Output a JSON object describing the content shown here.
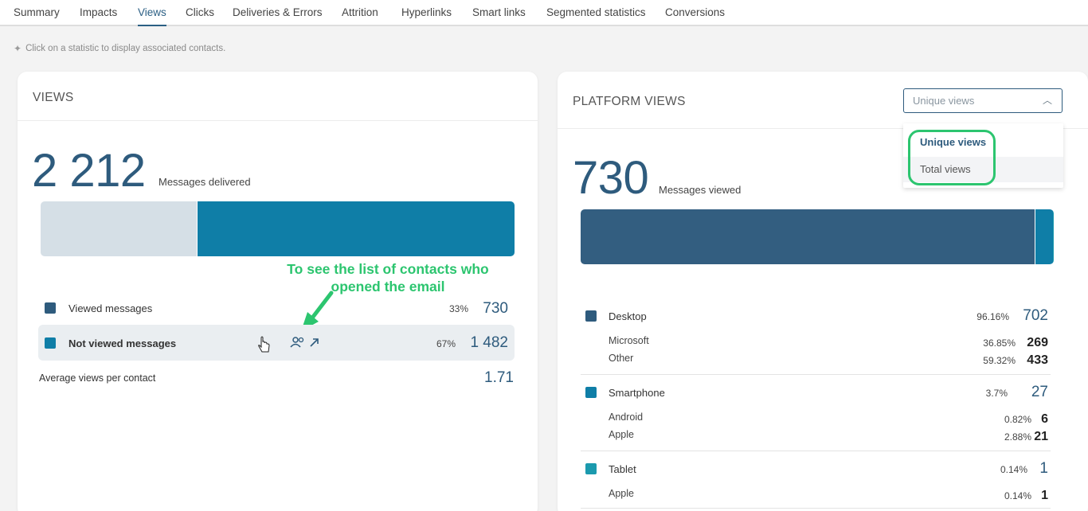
{
  "tabs": [
    "Summary",
    "Impacts",
    "Views",
    "Clicks",
    "Deliveries & Errors",
    "Attrition",
    "Hyperlinks",
    "Smart links",
    "Segmented statistics",
    "Conversions"
  ],
  "active_tab": "Views",
  "hint": "Click on a statistic to display associated contacts.",
  "views_card": {
    "title": "VIEWS",
    "total": "2 212",
    "total_label": "Messages delivered",
    "bar": {
      "viewed_fraction": 0.33,
      "not_viewed_fraction": 0.67
    },
    "rows": [
      {
        "label": "Viewed messages",
        "pct": "33%",
        "value": "730",
        "color": "#2e5b7d"
      },
      {
        "label": "Not viewed messages",
        "pct": "67%",
        "value": "1 482",
        "color": "#0f7ea7"
      }
    ],
    "avg_label": "Average views per contact",
    "avg_value": "1.71",
    "annotation": "To see the list of contacts who opened the email"
  },
  "platform_card": {
    "title": "PLATFORM VIEWS",
    "dropdown_value": "Unique views",
    "dropdown_options": [
      "Unique views",
      "Total views"
    ],
    "total": "730",
    "total_label": "Messages viewed",
    "bar": {
      "desktop_fraction": 0.9616,
      "smartphone_fraction": 0.037,
      "tablet_fraction": 0.0014
    },
    "groups": [
      {
        "label": "Desktop",
        "pct": "96.16%",
        "value": "702",
        "color": "#2e5b7d",
        "subs": [
          {
            "label": "Microsoft",
            "pct": "36.85%",
            "value": "269"
          },
          {
            "label": "Other",
            "pct": "59.32%",
            "value": "433"
          }
        ]
      },
      {
        "label": "Smartphone",
        "pct": "3.7%",
        "value": "27",
        "color": "#0f7ea7",
        "subs": [
          {
            "label": "Android",
            "pct": "0.82%",
            "value": "6"
          },
          {
            "label": "Apple",
            "pct": "2.88%",
            "value": "21"
          }
        ]
      },
      {
        "label": "Tablet",
        "pct": "0.14%",
        "value": "1",
        "color": "#1b9aae",
        "subs": [
          {
            "label": "Apple",
            "pct": "0.14%",
            "value": "1"
          }
        ]
      }
    ]
  },
  "colors": {
    "accent": "#2e5b7d",
    "secondary": "#0f7ea7",
    "tablet": "#1b9aae",
    "empty": "#d5dfe6",
    "annotation": "#2cc56f"
  }
}
